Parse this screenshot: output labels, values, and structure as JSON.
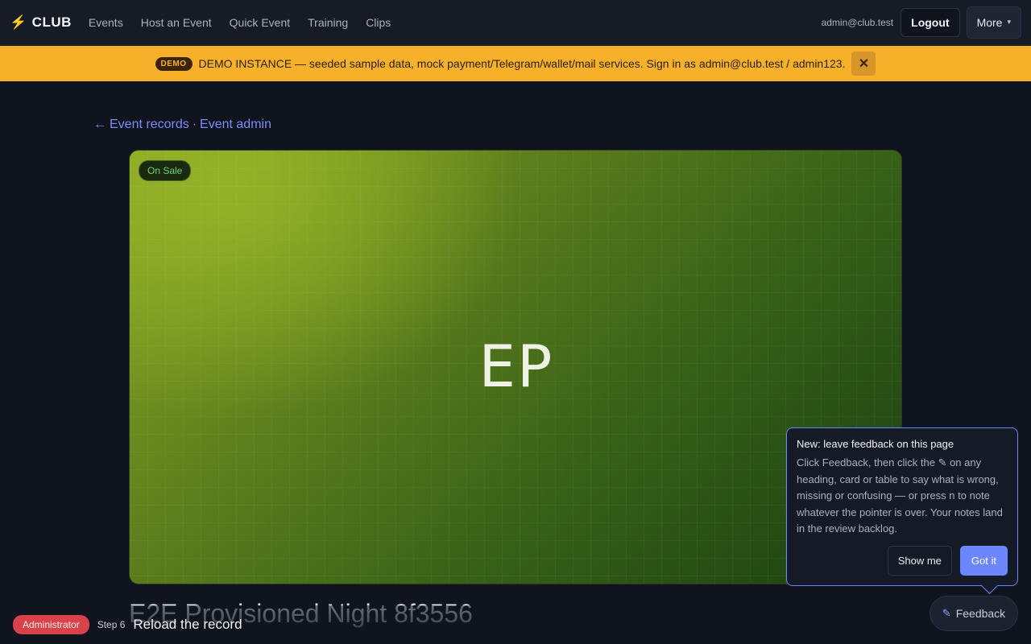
{
  "app": {
    "brand_icon": "⚡",
    "brand": "CLUB"
  },
  "nav": {
    "links": [
      "Events",
      "Host an Event",
      "Quick Event",
      "Training",
      "Clips"
    ],
    "user_email": "admin@club.test",
    "logout_label": "Logout",
    "more_label": "More",
    "more_caret": "▾"
  },
  "banner": {
    "pill": "DEMO",
    "text": "DEMO INSTANCE — seeded sample data, mock payment/Telegram/wallet/mail services. Sign in as admin@club.test / admin123.",
    "close": "✕",
    "color": "#f7b02a"
  },
  "breadcrumb": {
    "arrow": "←",
    "first": "Event records",
    "sep": "·",
    "second": "Event admin"
  },
  "event": {
    "status": "On Sale",
    "initials": "EP",
    "title": "E2E Provisioned Night 8f3556"
  },
  "tutorial": {
    "role": "Administrator",
    "step": "Step 6",
    "instruction": "Reload the record"
  },
  "popover": {
    "title": "New: leave feedback on this page",
    "body": "Click Feedback, then click the ✎ on any heading, card or table to say what is wrong, missing or confusing — or press n to note whatever the pointer is over. Your notes land in the review backlog.",
    "show_me": "Show me",
    "got_it": "Got it"
  },
  "feedback": {
    "icon": "✎",
    "label": "Feedback"
  },
  "colors": {
    "accent": "#6b86ff",
    "role_badge": "#d9424a",
    "status_green": "#6fd36a"
  }
}
